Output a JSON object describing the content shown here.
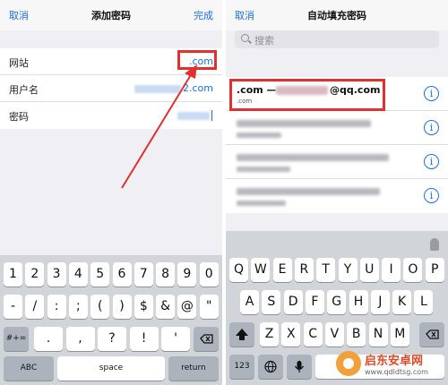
{
  "left": {
    "nav": {
      "cancel": "取消",
      "title": "添加密码",
      "done": "完成"
    },
    "fields": [
      {
        "label": "网站",
        "value": ".com"
      },
      {
        "label": "用户名",
        "value": "2.com"
      },
      {
        "label": "密码",
        "value": ""
      }
    ],
    "keyboard": {
      "row1": [
        "1",
        "2",
        "3",
        "4",
        "5",
        "6",
        "7",
        "8",
        "9",
        "0"
      ],
      "row2": [
        "-",
        "/",
        ":",
        ";",
        "(",
        ")",
        "$",
        "&",
        "@",
        "\""
      ],
      "row3_left": "#+=",
      "row3": [
        ".",
        ",",
        "?",
        "!",
        "'"
      ],
      "row4_left": "ABC",
      "row4_space": "space",
      "row4_return": "return"
    }
  },
  "right": {
    "nav": {
      "cancel": "取消",
      "title": "自动填充密码"
    },
    "search": {
      "placeholder": "搜索"
    },
    "items": [
      {
        "title": ".com —",
        "title_suffix": "@qq.com",
        "subtitle": ".com"
      },
      {
        "title": "",
        "subtitle": ""
      },
      {
        "title": "",
        "subtitle": ""
      },
      {
        "title": "",
        "subtitle": ""
      }
    ],
    "info_glyph": "i",
    "keyboard": {
      "row1": [
        "Q",
        "W",
        "E",
        "R",
        "T",
        "Y",
        "U",
        "I",
        "O",
        "P"
      ],
      "row2": [
        "A",
        "S",
        "D",
        "F",
        "G",
        "H",
        "J",
        "K",
        "L"
      ],
      "row3": [
        "Z",
        "X",
        "C",
        "V",
        "B",
        "N",
        "M"
      ],
      "row4_left": "123"
    }
  },
  "watermark": {
    "title": "启东安卓网",
    "url": "www.qdldtsg.com"
  },
  "colors": {
    "accent": "#1f6fe0",
    "highlight": "#e23030",
    "keyboard_bg": "#d1d4d9"
  }
}
